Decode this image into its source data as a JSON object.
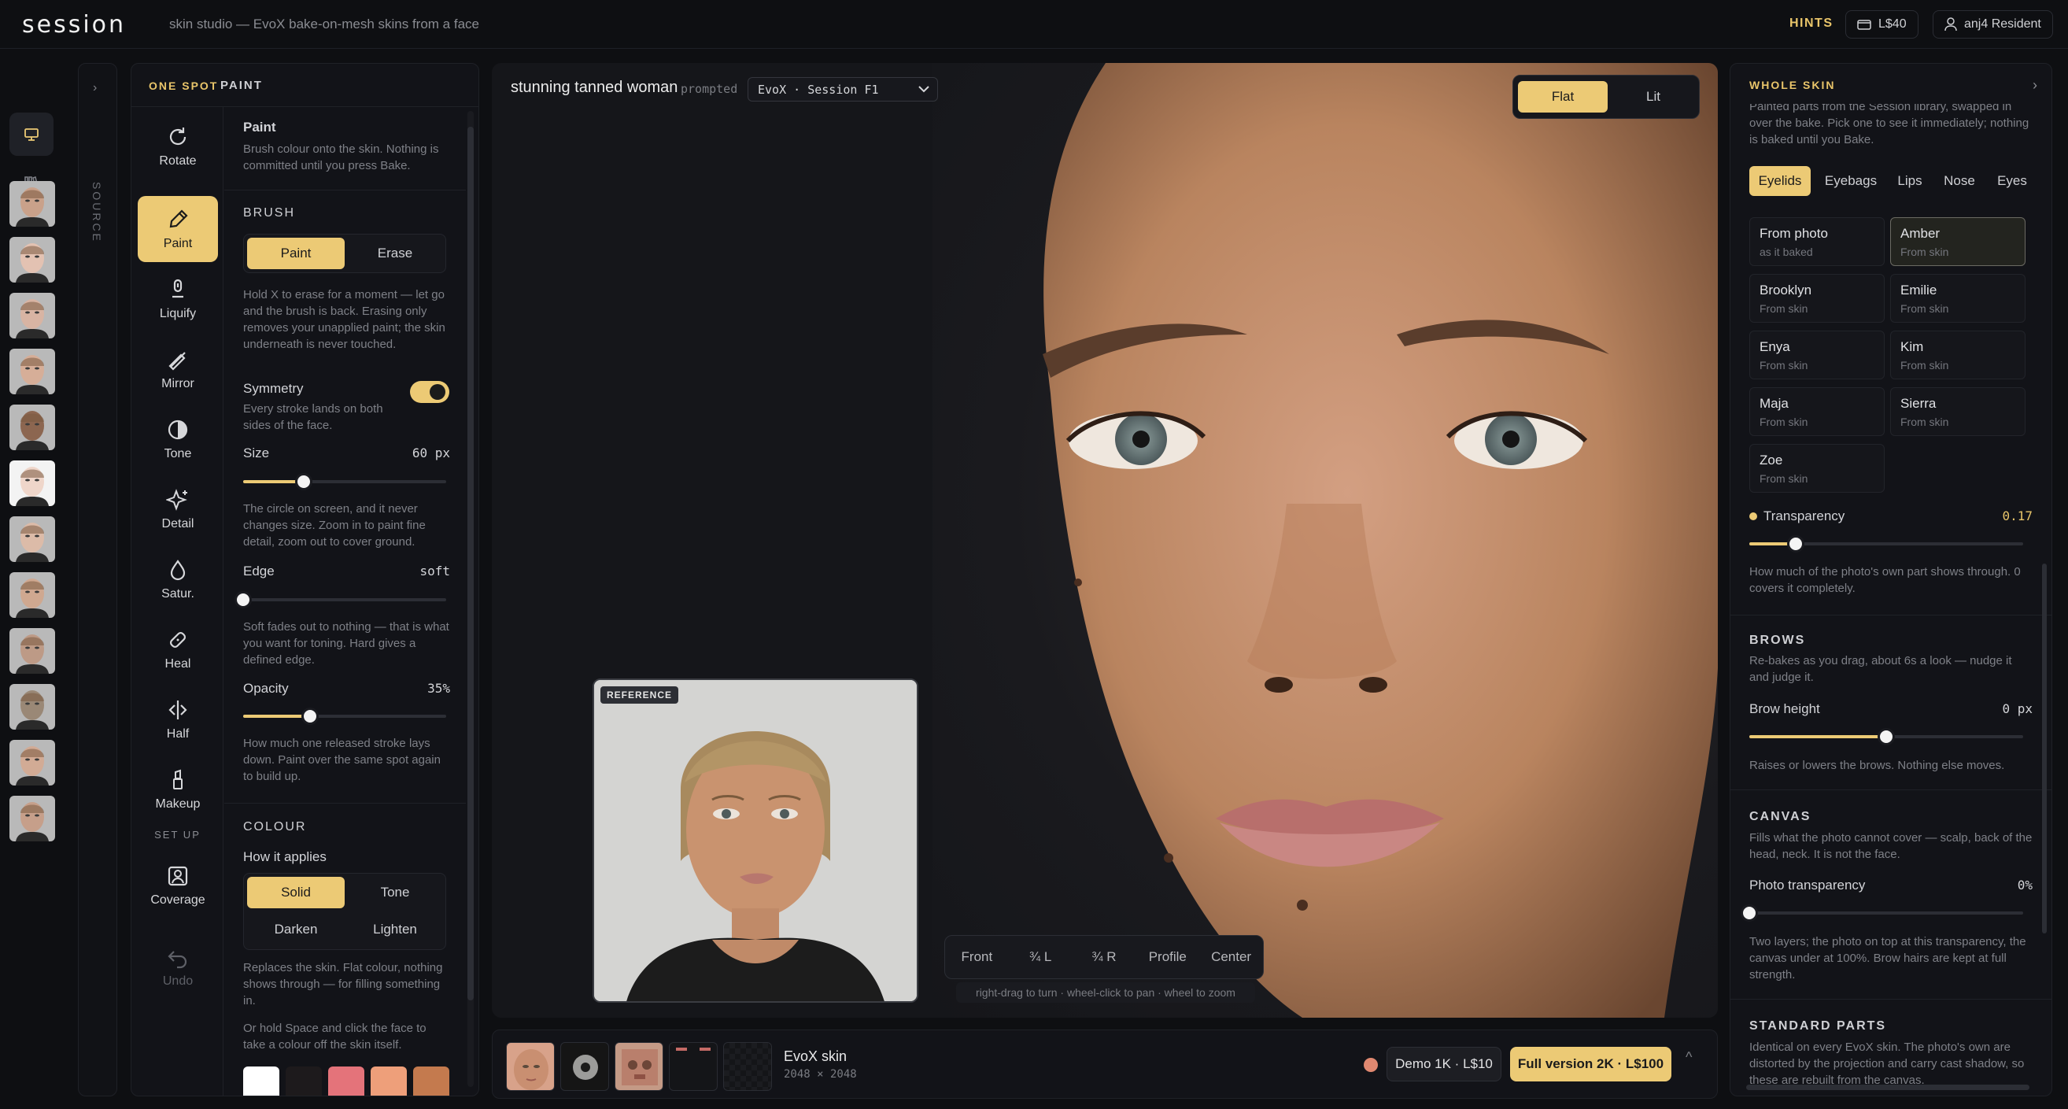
{
  "topbar": {
    "logo": "session",
    "tagline": "skin studio — EvoX bake-on-mesh skins from a face",
    "hints": "HINTS",
    "balance": "L$40",
    "user": "anj4 Resident"
  },
  "source": {
    "label": "SOURCE"
  },
  "tools_panel": {
    "eyebrow_a": "ONE SPOT",
    "eyebrow_b": "PAINT",
    "tools": [
      {
        "label": "Rotate",
        "icon": "rotate-icon"
      },
      {
        "label": "Paint",
        "icon": "brush-icon"
      },
      {
        "label": "Liquify",
        "icon": "liquify-icon"
      },
      {
        "label": "Mirror",
        "icon": "mirror-icon"
      },
      {
        "label": "Tone",
        "icon": "tone-icon"
      },
      {
        "label": "Detail",
        "icon": "sparkle-icon"
      },
      {
        "label": "Satur.",
        "icon": "droplet-icon"
      },
      {
        "label": "Heal",
        "icon": "bandage-icon"
      },
      {
        "label": "Half",
        "icon": "half-icon"
      },
      {
        "label": "Makeup",
        "icon": "lipstick-icon"
      }
    ],
    "setup_label": "SET UP",
    "coverage_label": "Coverage",
    "undo_label": "Undo"
  },
  "paint": {
    "title": "Paint",
    "desc": "Brush colour onto the skin. Nothing is committed until you press Bake.",
    "brush_title": "BRUSH",
    "mode": [
      "Paint",
      "Erase"
    ],
    "mode_help": "Hold X to erase for a moment — let go and the brush is back. Erasing only removes your unapplied paint; the skin underneath is never touched.",
    "symmetry_label": "Symmetry",
    "symmetry_help": "Every stroke lands on both sides of the face.",
    "symmetry_on": true,
    "size_label": "Size",
    "size_value": "60 px",
    "size_pos": 0.3,
    "size_help": "The circle on screen, and it never changes size. Zoom in to paint fine detail, zoom out to cover ground.",
    "edge_label": "Edge",
    "edge_value": "soft",
    "edge_pos": 0.0,
    "edge_help": "Soft fades out to nothing — that is what you want for toning. Hard gives a defined edge.",
    "opacity_label": "Opacity",
    "opacity_value": "35%",
    "opacity_pos": 0.33,
    "opacity_help": "How much one released stroke lays down. Paint over the same spot again to build up.",
    "colour_title": "COLOUR",
    "applies_label": "How it applies",
    "applies": [
      "Solid",
      "Tone",
      "Darken",
      "Lighten"
    ],
    "applies_help": "Replaces the skin. Flat colour, nothing shows through — for filling something in.",
    "pick_help": "Or hold Space and click the face to take a colour off the skin itself.",
    "swatches": [
      "#ffffff",
      "#1d1a1c",
      "#e4737a",
      "#ee9f7a",
      "#c47a4e"
    ]
  },
  "viewport": {
    "title": "stunning tanned woman",
    "prompted": "prompted",
    "model": "EvoX · Session F1",
    "shading": [
      "Flat",
      "Lit"
    ],
    "reference_badge": "REFERENCE",
    "camera": [
      "Front",
      "¾ L",
      "¾ R",
      "Profile",
      "Center"
    ],
    "hint": "right-drag to turn · wheel-click to pan · wheel to zoom"
  },
  "bottombar": {
    "skin_name": "EvoX skin",
    "skin_size": "2048 × 2048",
    "demo": "Demo 1K · L$10",
    "full": "Full version 2K · L$100"
  },
  "right_panel": {
    "title": "WHOLE SKIN",
    "intro": "Painted parts from the Session library, swapped in over the bake. Pick one to see it immediately; nothing is baked until you Bake.",
    "tabs": [
      "Eyelids",
      "Eyebags",
      "Lips",
      "Nose",
      "Eyes"
    ],
    "parts": [
      {
        "name": "From photo",
        "sub": "as it baked"
      },
      {
        "name": "Amber",
        "sub": "From skin"
      },
      {
        "name": "Brooklyn",
        "sub": "From skin"
      },
      {
        "name": "Emilie",
        "sub": "From skin"
      },
      {
        "name": "Enya",
        "sub": "From skin"
      },
      {
        "name": "Kim",
        "sub": "From skin"
      },
      {
        "name": "Maja",
        "sub": "From skin"
      },
      {
        "name": "Sierra",
        "sub": "From skin"
      },
      {
        "name": "Zoe",
        "sub": "From skin"
      }
    ],
    "transparency_label": "Transparency",
    "transparency_value": "0.17",
    "transparency_pos": 0.17,
    "transparency_help": "How much of the photo's own part shows through. 0 covers it completely.",
    "brows_title": "BROWS",
    "brows_help": "Re-bakes as you drag, about 6s a look — nudge it and judge it.",
    "brow_label": "Brow height",
    "brow_value": "0 px",
    "brow_pos": 0.5,
    "brow_help": "Raises or lowers the brows. Nothing else moves.",
    "canvas_title": "CANVAS",
    "canvas_help": "Fills what the photo cannot cover — scalp, back of the head, neck. It is not the face.",
    "photo_t_label": "Photo transparency",
    "photo_t_value": "0%",
    "photo_t_pos": 0.0,
    "photo_t_help": "Two layers; the photo on top at this transparency, the canvas under at 100%. Brow hairs are kept at full strength.",
    "standard_title": "STANDARD PARTS",
    "standard_help": "Identical on every EvoX skin. The photo's own are distorted by the projection and carry cast shadow, so these are rebuilt from the canvas."
  },
  "colors": {
    "accent": "#ecca75",
    "background": "#0e0f12",
    "panel": "#121318"
  }
}
